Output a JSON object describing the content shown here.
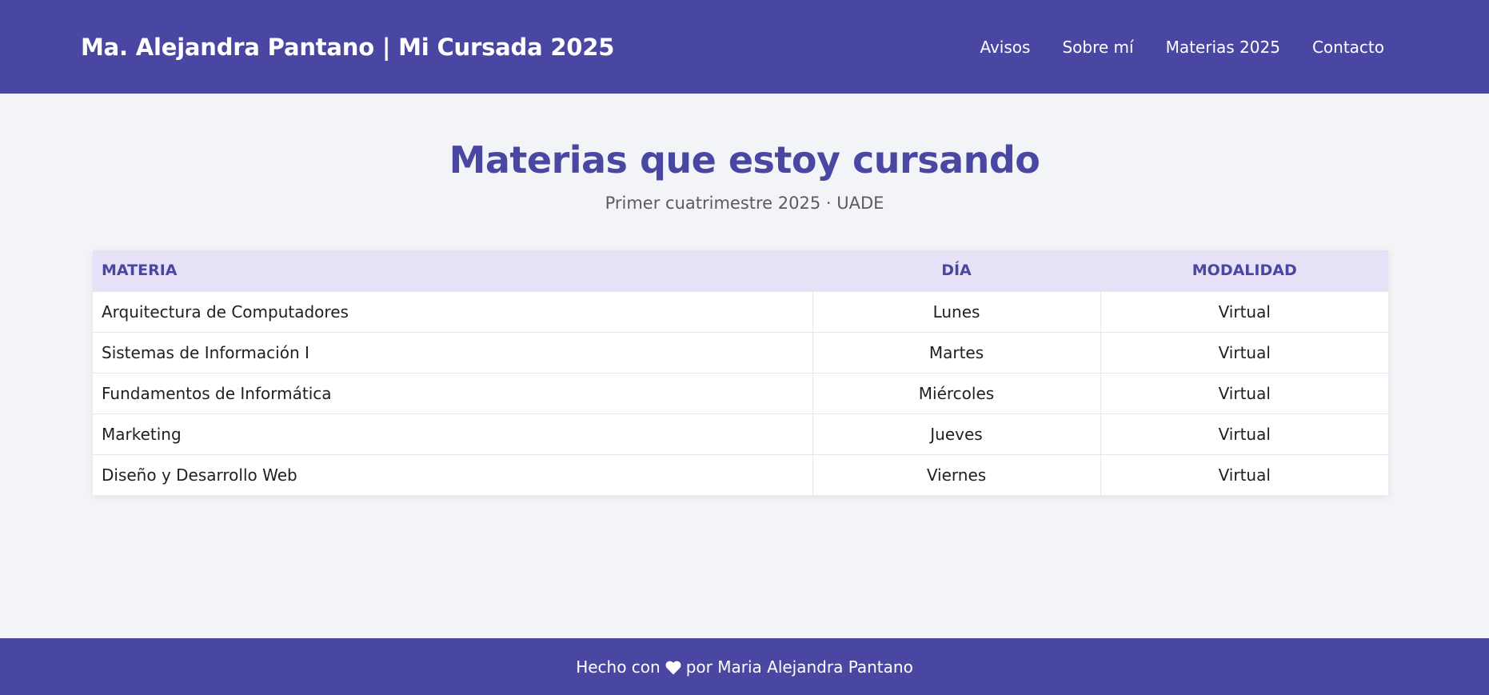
{
  "header": {
    "site_title": "Ma. Alejandra Pantano | Mi Cursada 2025",
    "nav": [
      {
        "label": "Avisos"
      },
      {
        "label": "Sobre mí"
      },
      {
        "label": "Materias 2025"
      },
      {
        "label": "Contacto"
      }
    ]
  },
  "main": {
    "title": "Materias que estoy cursando",
    "subtitle": "Primer cuatrimestre 2025 · UADE",
    "table": {
      "columns": [
        "Materia",
        "Día",
        "Modalidad"
      ],
      "rows": [
        {
          "materia": "Arquitectura de Computadores",
          "dia": "Lunes",
          "modalidad": "Virtual"
        },
        {
          "materia": "Sistemas de Información I",
          "dia": "Martes",
          "modalidad": "Virtual"
        },
        {
          "materia": "Fundamentos de Informática",
          "dia": "Miércoles",
          "modalidad": "Virtual"
        },
        {
          "materia": "Marketing",
          "dia": "Jueves",
          "modalidad": "Virtual"
        },
        {
          "materia": "Diseño y Desarrollo Web",
          "dia": "Viernes",
          "modalidad": "Virtual"
        }
      ]
    }
  },
  "footer": {
    "text_before": "Hecho con",
    "icon": "heart-icon",
    "text_after": "por Maria Alejandra Pantano"
  },
  "colors": {
    "brand": "#4a47a3",
    "header_row_bg": "#e6e1f6",
    "page_bg": "#f3f4f7"
  }
}
